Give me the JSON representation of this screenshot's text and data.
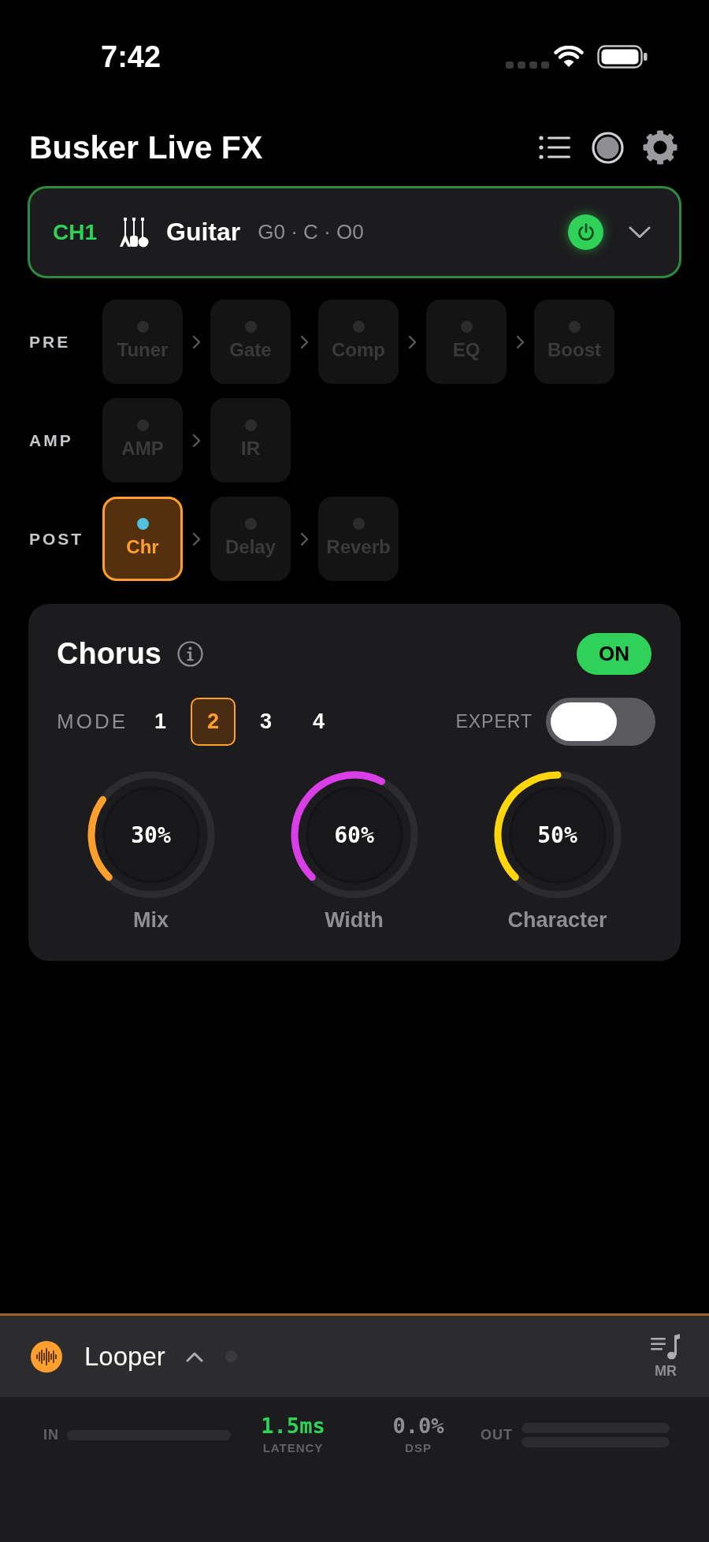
{
  "status_bar": {
    "time": "7:42"
  },
  "header": {
    "title": "Busker Live FX"
  },
  "channel": {
    "id": "CH1",
    "name": "Guitar",
    "routing": "G0 · C · O0",
    "on": true
  },
  "chain": [
    {
      "label": "PRE",
      "blocks": [
        {
          "name": "Tuner",
          "on": false,
          "selected": false
        },
        {
          "name": "Gate",
          "on": false,
          "selected": false
        },
        {
          "name": "Comp",
          "on": false,
          "selected": false
        },
        {
          "name": "EQ",
          "on": false,
          "selected": false
        },
        {
          "name": "Boost",
          "on": false,
          "selected": false
        }
      ]
    },
    {
      "label": "AMP",
      "blocks": [
        {
          "name": "AMP",
          "on": false,
          "selected": false
        },
        {
          "name": "IR",
          "on": false,
          "selected": false
        }
      ]
    },
    {
      "label": "POST",
      "blocks": [
        {
          "name": "Chr",
          "on": true,
          "selected": true
        },
        {
          "name": "Delay",
          "on": false,
          "selected": false
        },
        {
          "name": "Reverb",
          "on": false,
          "selected": false
        }
      ]
    }
  ],
  "effect": {
    "title": "Chorus",
    "on": true,
    "on_label": "ON",
    "mode_label": "MODE",
    "modes": [
      {
        "label": "1",
        "selected": false
      },
      {
        "label": "2",
        "selected": true
      },
      {
        "label": "3",
        "selected": false
      },
      {
        "label": "4",
        "selected": false
      }
    ],
    "expert_label": "EXPERT",
    "expert": false,
    "knobs": [
      {
        "label": "Mix",
        "reading": "30%",
        "color": "#ff9f2e"
      },
      {
        "label": "Width",
        "reading": "60%",
        "color": "#da3ee8"
      },
      {
        "label": "Character",
        "reading": "50%",
        "color": "#ffd60a"
      }
    ]
  },
  "looper": {
    "title": "Looper",
    "recording": false,
    "mr_label": "MR"
  },
  "meters": {
    "input": {
      "label": "IN",
      "level": 0
    },
    "latency": {
      "value": "1.5ms",
      "label": "LATENCY"
    },
    "dsp": {
      "value": "0.0%",
      "label": "DSP"
    },
    "output": {
      "label": "OUT",
      "channels": [
        {
          "level": 0
        },
        {
          "level": 0
        }
      ]
    }
  }
}
